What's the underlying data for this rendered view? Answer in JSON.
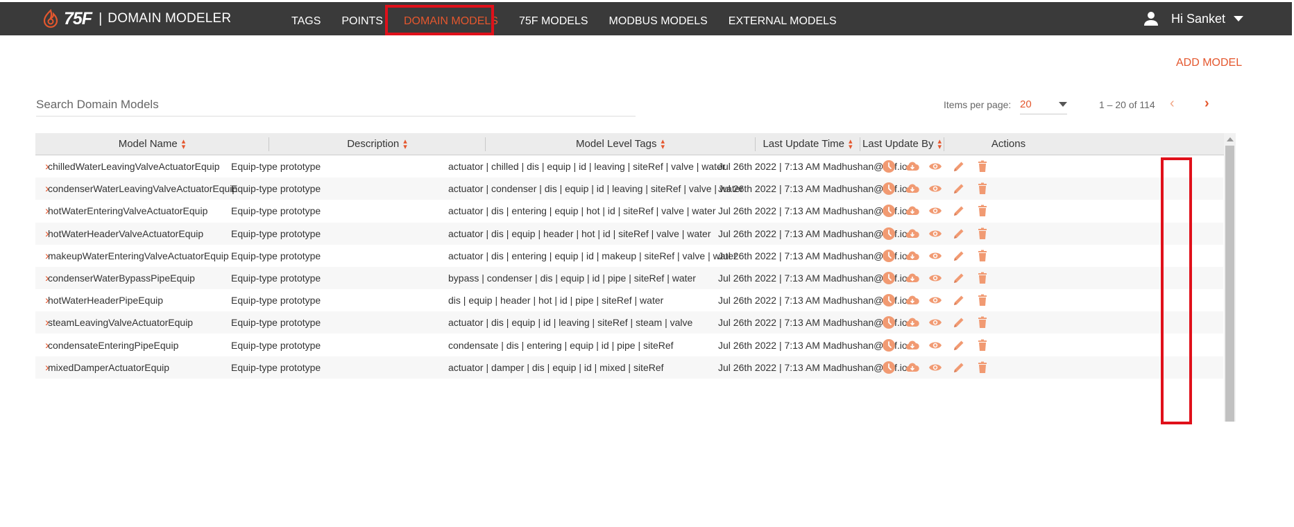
{
  "app": {
    "logo_text": "75F",
    "name": "DOMAIN MODELER"
  },
  "nav": [
    "TAGS",
    "POINTS",
    "DOMAIN MODELS",
    "75F MODELS",
    "MODBUS MODELS",
    "EXTERNAL MODELS"
  ],
  "nav_active_index": 2,
  "user": {
    "greeting": "Hi Sanket"
  },
  "actions": {
    "add_model": "ADD MODEL"
  },
  "search": {
    "placeholder": "Search Domain Models"
  },
  "pagination": {
    "items_per_page_label": "Items per page:",
    "items_per_page": "20",
    "range": "1 – 20 of 114",
    "prev": "‹",
    "next": "›"
  },
  "table": {
    "headers": [
      "Model Name",
      "Description",
      "Model Level Tags",
      "Last Update Time",
      "Last Update By",
      "Actions"
    ],
    "rows": [
      {
        "name": "chilledWaterLeavingValveActuatorEquip",
        "description": "Equip-type prototype",
        "tags": "actuator | chilled | dis | equip | id | leaving | siteRef | valve | water",
        "time": "Jul 26th 2022 | 7:13 AM",
        "by": "Madhushan@75f.io"
      },
      {
        "name": "condenserWaterLeavingValveActuatorEquip",
        "description": "Equip-type prototype",
        "tags": "actuator | condenser | dis | equip | id | leaving | siteRef | valve | water",
        "time": "Jul 26th 2022 | 7:13 AM",
        "by": "Madhushan@75f.io"
      },
      {
        "name": "hotWaterEnteringValveActuatorEquip",
        "description": "Equip-type prototype",
        "tags": "actuator | dis | entering | equip | hot | id | siteRef | valve | water",
        "time": "Jul 26th 2022 | 7:13 AM",
        "by": "Madhushan@75f.io"
      },
      {
        "name": "hotWaterHeaderValveActuatorEquip",
        "description": "Equip-type prototype",
        "tags": "actuator | dis | equip | header | hot | id | siteRef | valve | water",
        "time": "Jul 26th 2022 | 7:13 AM",
        "by": "Madhushan@75f.io"
      },
      {
        "name": "makeupWaterEnteringValveActuatorEquip",
        "description": "Equip-type prototype",
        "tags": "actuator | dis | entering | equip | id | makeup | siteRef | valve | water",
        "time": "Jul 26th 2022 | 7:13 AM",
        "by": "Madhushan@75f.io"
      },
      {
        "name": "condenserWaterBypassPipeEquip",
        "description": "Equip-type prototype",
        "tags": "bypass | condenser | dis | equip | id | pipe | siteRef | water",
        "time": "Jul 26th 2022 | 7:13 AM",
        "by": "Madhushan@75f.io"
      },
      {
        "name": "hotWaterHeaderPipeEquip",
        "description": "Equip-type prototype",
        "tags": "dis | equip | header | hot | id | pipe | siteRef | water",
        "time": "Jul 26th 2022 | 7:13 AM",
        "by": "Madhushan@75f.io"
      },
      {
        "name": "steamLeavingValveActuatorEquip",
        "description": "Equip-type prototype",
        "tags": "actuator | dis | equip | id | leaving | siteRef | steam | valve",
        "time": "Jul 26th 2022 | 7:13 AM",
        "by": "Madhushan@75f.io"
      },
      {
        "name": "condensateEnteringPipeEquip",
        "description": "Equip-type prototype",
        "tags": "condensate | dis | entering | equip | id | pipe | siteRef",
        "time": "Jul 26th 2022 | 7:13 AM",
        "by": "Madhushan@75f.io"
      },
      {
        "name": "mixedDamperActuatorEquip",
        "description": "Equip-type prototype",
        "tags": "actuator | damper | dis | equip | id | mixed | siteRef",
        "time": "Jul 26th 2022 | 7:13 AM",
        "by": "Madhushan@75f.io"
      }
    ],
    "row_actions": [
      "history-icon",
      "cloud-download-icon",
      "eye-icon",
      "pencil-icon",
      "trash-icon"
    ]
  },
  "colors": {
    "accent": "#e4572e",
    "topbar": "#3a3a3a",
    "highlight": "#e0101a",
    "icon_orange": "#f19a72"
  }
}
